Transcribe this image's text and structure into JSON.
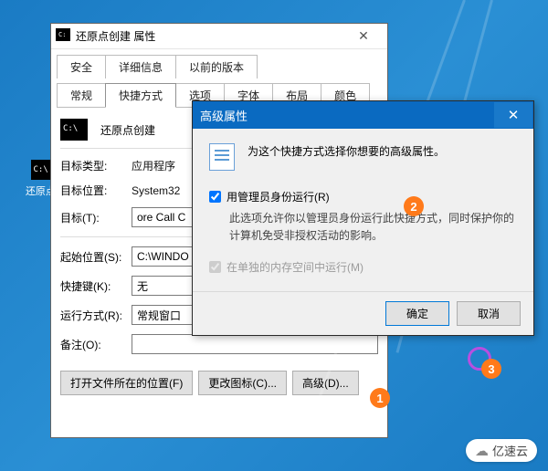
{
  "desktop": {
    "icon_label": "还原点.."
  },
  "props_window": {
    "title": "还原点创建 属性",
    "tabs_row1": [
      "安全",
      "详细信息",
      "以前的版本"
    ],
    "tabs_row2": [
      "常规",
      "快捷方式",
      "选项",
      "字体",
      "布局",
      "颜色"
    ],
    "active_tab": "快捷方式",
    "app_name": "还原点创建",
    "fields": {
      "target_type_label": "目标类型:",
      "target_type_value": "应用程序",
      "target_loc_label": "目标位置:",
      "target_loc_value": "System32",
      "target_label": "目标(T):",
      "target_value": "ore Call C",
      "startin_label": "起始位置(S):",
      "startin_value": "C:\\WINDO",
      "shortcut_label": "快捷键(K):",
      "shortcut_value": "无",
      "runmode_label": "运行方式(R):",
      "runmode_value": "常规窗口",
      "comment_label": "备注(O):",
      "comment_value": ""
    },
    "buttons": {
      "open_location": "打开文件所在的位置(F)",
      "change_icon": "更改图标(C)...",
      "advanced": "高级(D)..."
    }
  },
  "adv_dialog": {
    "title": "高级属性",
    "intro": "为这个快捷方式选择你想要的高级属性。",
    "admin_label": "用管理员身份运行(R)",
    "admin_desc": "此选项允许你以管理员身份运行此快捷方式，同时保护你的计算机免受非授权活动的影响。",
    "separate_mem_label": "在单独的内存空间中运行(M)",
    "ok": "确定",
    "cancel": "取消"
  },
  "callouts": {
    "c1": "1",
    "c2": "2",
    "c3": "3"
  },
  "watermark": "亿速云"
}
